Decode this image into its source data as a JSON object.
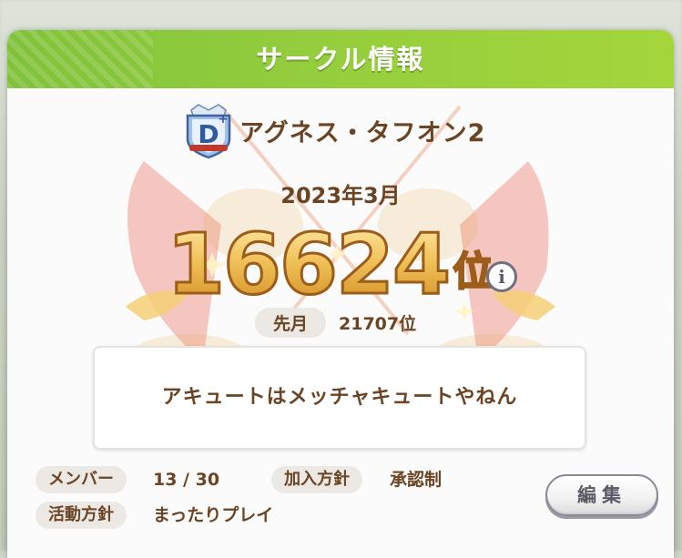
{
  "header": {
    "title": "サークル情報"
  },
  "circle": {
    "rank_badge_letter": "D",
    "rank_badge_plus": "+",
    "name": "アグネス・タフオン2"
  },
  "ranking": {
    "month": "2023年3月",
    "rank": "16624",
    "rank_unit": "位",
    "info_icon": "i",
    "previous_label": "先月",
    "previous_value": "21707位"
  },
  "message": "アキュートはメッチャキュートやねん",
  "details": {
    "members_label": "メンバー",
    "members_value": "13 / 30",
    "join_policy_label": "加入方針",
    "join_policy_value": "承認制",
    "activity_label": "活動方針",
    "activity_value": "まったりプレイ"
  },
  "buttons": {
    "edit": "編集"
  },
  "colors": {
    "header_green": "#94cd3d",
    "text_brown": "#6b4424",
    "gold": "#e4b146"
  }
}
